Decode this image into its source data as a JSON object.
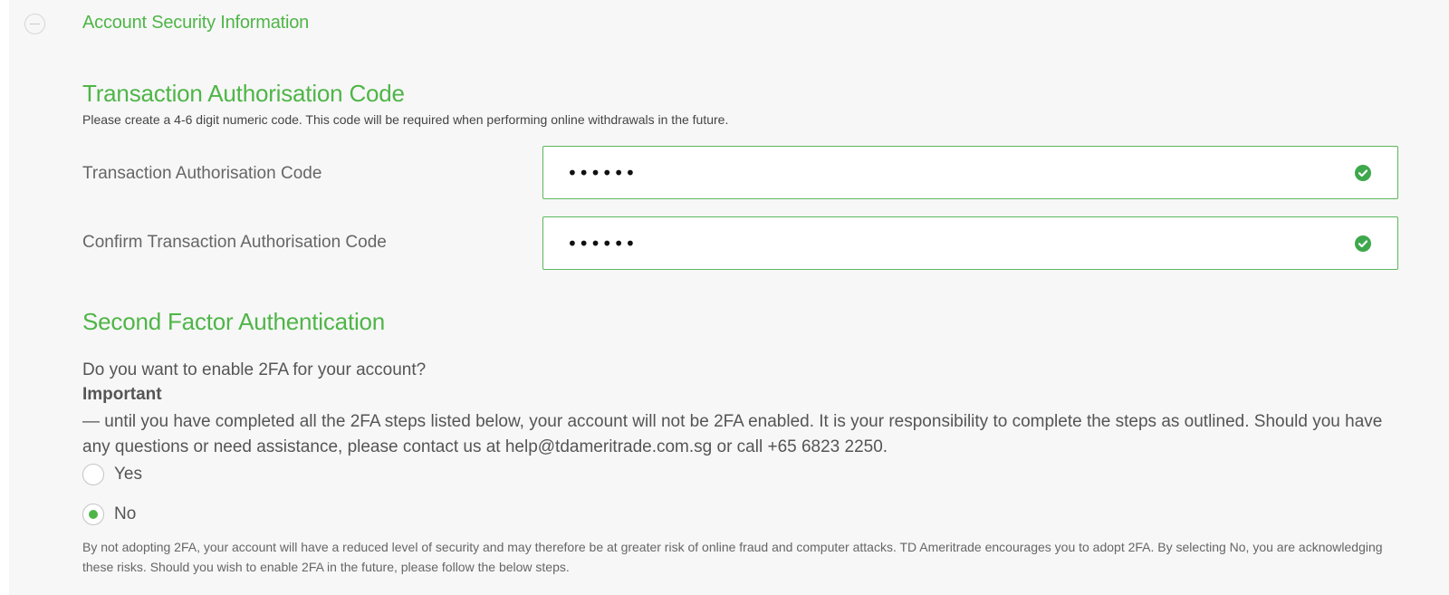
{
  "section": {
    "title": "Account Security Information",
    "collapse_icon": "minus-circle-icon"
  },
  "transaction_code": {
    "title": "Transaction Authorisation Code",
    "description": "Please create a 4-6 digit numeric code. This code will be required when performing online withdrawals in the future.",
    "fields": [
      {
        "label": "Transaction Authorisation Code",
        "value": "••••••",
        "status": "valid",
        "status_icon": "check-circle-icon"
      },
      {
        "label": "Confirm Transaction Authorisation Code",
        "value": "••••••",
        "status": "valid",
        "status_icon": "check-circle-icon"
      }
    ]
  },
  "two_factor": {
    "title": "Second Factor Authentication",
    "question": "Do you want to enable 2FA for your account?",
    "important_label": "Important",
    "important_text": "— until you have completed all the 2FA steps listed below, your account will not be 2FA enabled. It is your responsibility to complete the steps as outlined. Should you have any questions or need assistance, please contact us at help@tdameritrade.com.sg or call +65 6823 2250.",
    "options": [
      {
        "label": "Yes",
        "selected": false
      },
      {
        "label": "No",
        "selected": true
      }
    ],
    "footnote": "By not adopting 2FA, your account will have a reduced level of security and may therefore be at greater risk of online fraud and computer attacks. TD Ameritrade encourages you to adopt 2FA. By selecting No, you are acknowledging these risks. Should you wish to enable 2FA in the future, please follow the below steps."
  },
  "colors": {
    "accent": "#4fb548",
    "valid_border": "#5cb85c",
    "check": "#3ea84c",
    "panel_bg": "#f7f7f7"
  }
}
